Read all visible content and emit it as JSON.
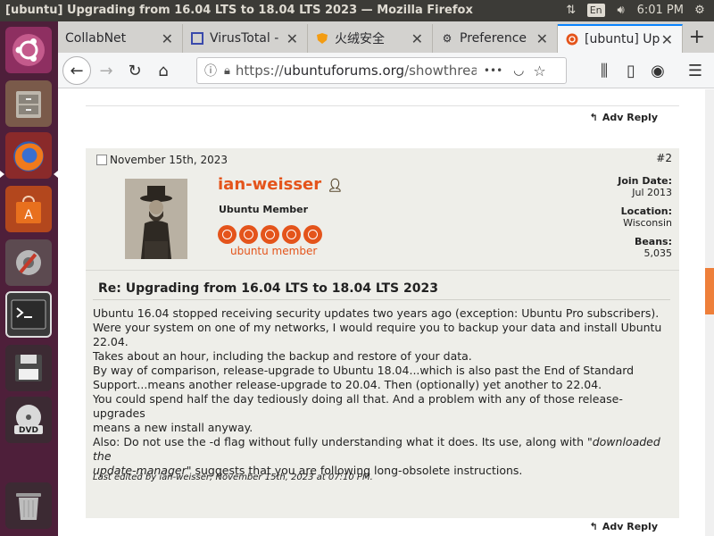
{
  "system": {
    "window_title": "[ubuntu] Upgrading from 16.04 LTS to 18.04 LTS 2023 — Mozilla Firefox",
    "keyboard_layout": "En",
    "clock": "6:01 PM"
  },
  "launcher": {
    "items": [
      "ubuntu-dash",
      "files",
      "firefox",
      "software-center",
      "system-settings",
      "terminal",
      "save-disk",
      "dvd-drive",
      "trash"
    ]
  },
  "tabs": [
    {
      "label": "CollabNet",
      "icon": "blank-icon"
    },
    {
      "label": "VirusTotal -",
      "icon": "virustotal-icon"
    },
    {
      "label": "火绒安全",
      "icon": "shield-icon"
    },
    {
      "label": "Preference",
      "icon": "gear-icon"
    },
    {
      "label": "[ubuntu] Up",
      "icon": "ubuntu-icon"
    }
  ],
  "nav": {
    "url_prefix": "https://",
    "url_host": "ubuntuforums.org",
    "url_rest": "/showthread",
    "more": "•••"
  },
  "page": {
    "adv_reply": "Adv Reply",
    "post": {
      "date": "November 15th, 2023",
      "number": "#2",
      "username": "ian-weisser",
      "user_title": "Ubuntu Member",
      "user_rank": "ubuntu member",
      "join_label": "Join Date:",
      "join_value": "Jul 2013",
      "location_label": "Location:",
      "location_value": "Wisconsin",
      "beans_label": "Beans:",
      "beans_value": "5,035",
      "title": "Re: Upgrading from 16.04 LTS to 18.04 LTS 2023",
      "p1_l1": "Ubuntu 16.04 stopped receiving security updates two years ago (exception: Ubuntu Pro subscribers).",
      "p1_l2": "Were your system on one of my networks, I would require you to backup your data and install Ubuntu 22.04.",
      "p1_l3": "Takes about an hour, including the backup and restore of your data.",
      "p2_l1": "By way of comparison, release-upgrade to Ubuntu 18.04...which is also past the End of Standard",
      "p2_l2": "Support...means another release-upgrade to 20.04. Then (optionally) yet another to 22.04.",
      "p2_l3": "You could spend half the day tediously doing all that. And a problem with any of those release-upgrades",
      "p2_l4": "means a new install anyway.",
      "p3_a": "Also: Do not use the -d flag without fully understanding what it does. Its use, along with \"",
      "p3_em1": "downloaded the",
      "p3_em2": "update-manager",
      "p3_b": "\" suggests that you are following long-obsolete instructions.",
      "edited": "Last edited by ian-weisser; November 15th, 2023 at 07:10 PM."
    }
  },
  "colors": {
    "accent": "#e4541b",
    "launcher_bg": "#4e1f3a",
    "topbar_bg": "#3c3b37",
    "post_bg": "#eeeee9",
    "scroll_thumb": "#ee7f3a"
  }
}
